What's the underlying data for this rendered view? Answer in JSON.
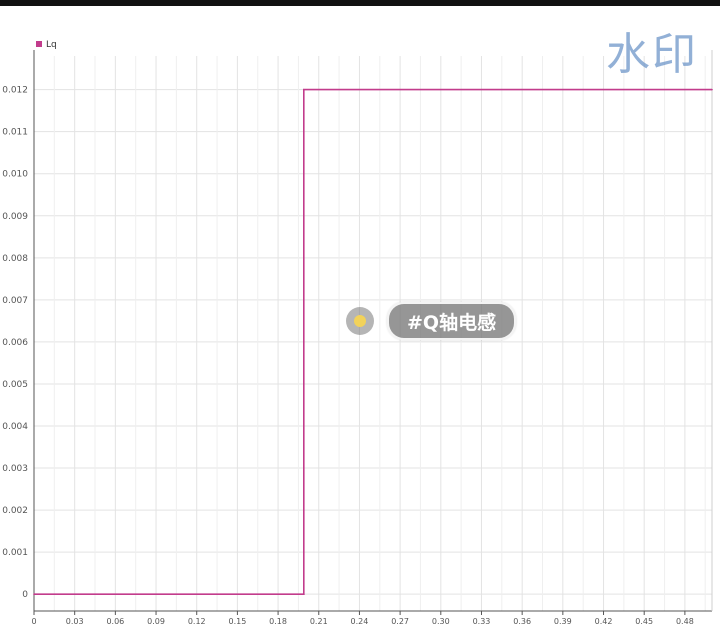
{
  "chart_data": {
    "type": "line",
    "legend": {
      "position": "top-left"
    },
    "series": [
      {
        "name": "Lq",
        "color": "#c23c8c",
        "x": [
          0,
          0.199,
          0.199,
          0.5
        ],
        "y": [
          0,
          0,
          0.012,
          0.012
        ]
      }
    ],
    "x_ticks": [
      "0",
      "0.03",
      "0.06",
      "0.09",
      "0.12",
      "0.15",
      "0.18",
      "0.21",
      "0.24",
      "0.27",
      "0.30",
      "0.33",
      "0.36",
      "0.39",
      "0.42",
      "0.45",
      "0.48"
    ],
    "y_ticks": [
      "0",
      "0.001",
      "0.002",
      "0.003",
      "0.004",
      "0.005",
      "0.006",
      "0.007",
      "0.008",
      "0.009",
      "0.010",
      "0.011",
      "0.012"
    ],
    "xlim": [
      0,
      0.5
    ],
    "ylim": [
      -0.0004,
      0.0128
    ],
    "grid": true
  },
  "overlay": {
    "tag_text": "#Q轴电感",
    "watermark": "水印"
  },
  "colors": {
    "series": "#c23c8c",
    "grid": "#e3e3e3",
    "axis": "#555555",
    "tick_label": "#555555"
  }
}
